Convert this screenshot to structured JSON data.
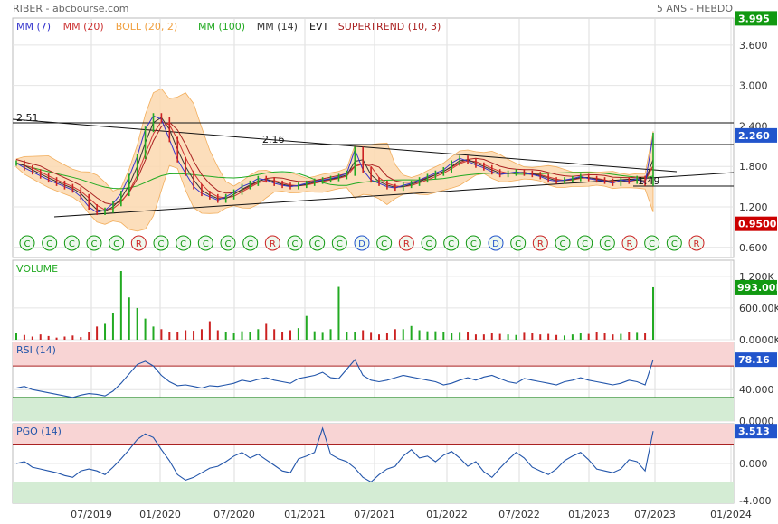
{
  "header": {
    "left": "RIBER - abcbourse.com",
    "right": "5 ANS - HEBDO"
  },
  "legend": [
    {
      "label": "MM (7)",
      "color": "#3333cc"
    },
    {
      "label": "MM (20)",
      "color": "#cc3333"
    },
    {
      "label": "BOLL (20, 2)",
      "color": "#f0a040"
    },
    {
      "label": "MM (100)",
      "color": "#22aa22"
    },
    {
      "label": "MM (14)",
      "color": "#333333"
    },
    {
      "label": "EVT",
      "color": "#111111"
    },
    {
      "label": "SUPERTREND (10, 3)",
      "color": "#aa2222"
    }
  ],
  "colors": {
    "price_line": "#009900",
    "bars_up": "#22aa22",
    "bars_down": "#cc2222",
    "boll_fill": "#fcd9b0",
    "rsi_line": "#2255aa",
    "upper_zone": "#f8d4d4",
    "lower_zone": "#d4ecd4",
    "badge_green": "#119911",
    "badge_red": "#cc0000",
    "badge_blue": "#2255cc"
  },
  "x_axis_labels": [
    "07/2019",
    "01/2020",
    "07/2020",
    "01/2021",
    "07/2021",
    "01/2022",
    "07/2022",
    "01/2023",
    "07/2023",
    "01/2024"
  ],
  "chart_data": [
    {
      "type": "line",
      "name": "price",
      "title": "",
      "y_ticks": [
        "3.600",
        "3.000",
        "2.400",
        "1.800",
        "1.200",
        "0.600"
      ],
      "ylim": [
        0.45,
        4.0
      ],
      "annotations": [
        "2.51",
        "2.16",
        "1.49"
      ],
      "badges": [
        {
          "value": "3.995",
          "color": "green"
        },
        {
          "value": "2.260",
          "color": "blue"
        },
        {
          "value": "0.9500",
          "color": "red"
        }
      ],
      "signal_markers": [
        "C",
        "C",
        "C",
        "C",
        "C",
        "R",
        "C",
        "C",
        "C",
        "C",
        "C",
        "R",
        "C",
        "C",
        "C",
        "D",
        "C",
        "R",
        "C",
        "C",
        "C",
        "D",
        "C",
        "R",
        "C",
        "C",
        "C",
        "R",
        "C",
        "C",
        "R"
      ],
      "series": [
        {
          "values": [
            1.85,
            1.78,
            1.72,
            1.66,
            1.6,
            1.55,
            1.5,
            1.45,
            1.35,
            1.2,
            1.12,
            1.15,
            1.25,
            1.4,
            1.65,
            1.95,
            2.35,
            2.55,
            2.5,
            2.2,
            1.9,
            1.7,
            1.5,
            1.4,
            1.35,
            1.3,
            1.35,
            1.42,
            1.5,
            1.55,
            1.62,
            1.6,
            1.55,
            1.52,
            1.5,
            1.52,
            1.55,
            1.58,
            1.6,
            1.62,
            1.65,
            1.7,
            2.05,
            1.75,
            1.6,
            1.55,
            1.5,
            1.48,
            1.52,
            1.55,
            1.6,
            1.65,
            1.7,
            1.75,
            1.85,
            1.92,
            1.88,
            1.82,
            1.78,
            1.72,
            1.68,
            1.7,
            1.72,
            1.7,
            1.68,
            1.65,
            1.6,
            1.58,
            1.6,
            1.62,
            1.65,
            1.62,
            1.6,
            1.58,
            1.55,
            1.6,
            1.58,
            1.62,
            1.55,
            2.26
          ]
        }
      ]
    },
    {
      "type": "bar",
      "name": "volume",
      "title": "VOLUME",
      "y_ticks": [
        "1 200K",
        "600.00K",
        "0.0000K"
      ],
      "ylim": [
        0,
        1300
      ],
      "badge": "993.00K",
      "values": [
        120,
        90,
        60,
        100,
        70,
        40,
        60,
        80,
        50,
        150,
        250,
        300,
        500,
        1300,
        800,
        600,
        400,
        250,
        200,
        150,
        150,
        180,
        170,
        200,
        350,
        180,
        150,
        120,
        160,
        140,
        200,
        300,
        200,
        150,
        180,
        220,
        450,
        160,
        130,
        200,
        1000,
        140,
        150,
        180,
        130,
        100,
        120,
        200,
        200,
        260,
        180,
        160,
        160,
        150,
        120,
        130,
        140,
        100,
        100,
        120,
        110,
        100,
        90,
        130,
        120,
        100,
        110,
        90,
        80,
        100,
        120,
        110,
        140,
        120,
        100,
        110,
        150,
        130,
        120,
        993
      ]
    },
    {
      "type": "line",
      "name": "rsi",
      "title": "RSI (14)",
      "y_ticks": [
        "40.000",
        "0.0000"
      ],
      "ylim": [
        0,
        100
      ],
      "zones": [
        70,
        30
      ],
      "badge": "78.16",
      "values": [
        42,
        44,
        40,
        38,
        36,
        34,
        32,
        30,
        33,
        35,
        34,
        32,
        38,
        48,
        60,
        72,
        76,
        70,
        58,
        50,
        45,
        46,
        44,
        42,
        45,
        44,
        46,
        48,
        52,
        50,
        53,
        55,
        52,
        50,
        48,
        54,
        56,
        58,
        62,
        55,
        54,
        66,
        78,
        58,
        52,
        50,
        52,
        55,
        58,
        56,
        54,
        52,
        50,
        46,
        48,
        52,
        55,
        52,
        56,
        58,
        54,
        50,
        48,
        54,
        52,
        50,
        48,
        46,
        50,
        52,
        55,
        52,
        50,
        48,
        46,
        48,
        52,
        50,
        46,
        78
      ]
    },
    {
      "type": "line",
      "name": "pgo",
      "title": "PGO (14)",
      "y_ticks": [
        "0.000",
        "-4.000"
      ],
      "ylim": [
        -4.3,
        4.3
      ],
      "zones": [
        2,
        -2
      ],
      "badge": "3.513",
      "values": [
        0,
        0.2,
        -0.4,
        -0.6,
        -0.8,
        -1,
        -1.3,
        -1.5,
        -0.8,
        -0.6,
        -0.8,
        -1.2,
        -0.4,
        0.5,
        1.5,
        2.6,
        3.2,
        2.8,
        1.5,
        0.3,
        -1.2,
        -1.8,
        -1.5,
        -1,
        -0.5,
        -0.3,
        0.2,
        0.8,
        1.2,
        0.6,
        1.0,
        0.4,
        -0.2,
        -0.8,
        -1.0,
        0.5,
        0.8,
        1.2,
        3.8,
        1.0,
        0.5,
        0.2,
        -0.5,
        -1.5,
        -2.0,
        -1.2,
        -0.6,
        -0.3,
        0.8,
        1.5,
        0.6,
        0.8,
        0.2,
        0.9,
        1.3,
        0.6,
        -0.3,
        0.2,
        -0.9,
        -1.5,
        -0.5,
        0.4,
        1.2,
        0.6,
        -0.4,
        -0.8,
        -1.2,
        -0.6,
        0.3,
        0.8,
        1.2,
        0.4,
        -0.6,
        -0.8,
        -1.0,
        -0.6,
        0.4,
        0.2,
        -0.8,
        3.5
      ]
    }
  ]
}
